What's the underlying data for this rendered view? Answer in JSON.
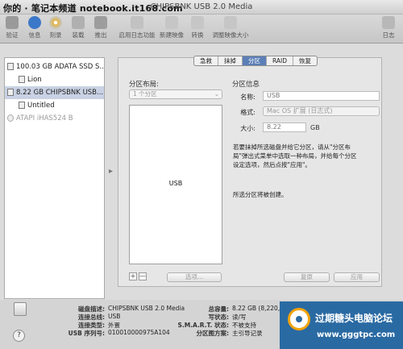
{
  "window": {
    "title": "CHIPSBNK USB 2.0 Media",
    "watermark": "你的 · 笔记本频道 notebook.it168.com"
  },
  "toolbar": {
    "items": [
      "验证",
      "信息",
      "刻录",
      "装载",
      "推出",
      "启用日志功能",
      "新建映像",
      "转换",
      "调整映像大小"
    ],
    "right_item": "日志"
  },
  "sidebar": {
    "items": [
      {
        "label": "100.03 GB ADATA SSD S...",
        "kind": "disk"
      },
      {
        "label": "Lion",
        "kind": "volume"
      },
      {
        "label": "8.22 GB CHIPSBNK USB...",
        "kind": "disk",
        "selected": true
      },
      {
        "label": "Untitled",
        "kind": "volume"
      },
      {
        "label": "ATAPI iHAS524 B",
        "kind": "optical"
      }
    ]
  },
  "tabs": [
    {
      "label": "急救",
      "active": false
    },
    {
      "label": "抹掉",
      "active": false
    },
    {
      "label": "分区",
      "active": true
    },
    {
      "label": "RAID",
      "active": false
    },
    {
      "label": "恢复",
      "active": false
    }
  ],
  "partition": {
    "layout_label": "分区布局:",
    "layout_select": "1 个分区",
    "partition_name": "USB",
    "plus": "+",
    "minus": "—",
    "options_button": "选项..."
  },
  "info": {
    "section_label": "分区信息",
    "name_label": "名称:",
    "name_value": "USB",
    "format_label": "格式:",
    "format_value": "Mac OS 扩展 (日志式)",
    "size_label": "大小:",
    "size_value": "8.22",
    "size_unit": "GB",
    "help_text": "若要抹掉所选磁盘并给它分区，请从\"分区布局\"弹出式菜单中选取一种布局，并给每个分区设定选项，然后点按\"应用\"。",
    "status_text": "所选分区将被创建。",
    "revert_button": "复原",
    "apply_button": "应用"
  },
  "details": {
    "left": [
      {
        "key": "磁盘描述:",
        "value": "CHIPSBNK USB 2.0 Media"
      },
      {
        "key": "连接总线:",
        "value": "USB"
      },
      {
        "key": "连接类型:",
        "value": "外置"
      },
      {
        "key": "USB 序列号:",
        "value": "010010000975A104"
      }
    ],
    "right": [
      {
        "key": "总容量:",
        "value": "8.22 GB (8,220,835,8"
      },
      {
        "key": "写状态:",
        "value": "读/写"
      },
      {
        "key": "S.M.A.R.T. 状态:",
        "value": "不被支持"
      },
      {
        "key": "分区图方案:",
        "value": "主引导记录"
      }
    ]
  },
  "help_button": "?",
  "forum_logo": {
    "name": "过期糖头电脑论坛",
    "url": "www.gggtpc.com"
  },
  "colors": {
    "tab_active": "#5c7fb7",
    "sidebar_selected": "#c9d2e4",
    "forum_bg": "#2a6aa3",
    "forum_ring": "#f2a30b"
  }
}
